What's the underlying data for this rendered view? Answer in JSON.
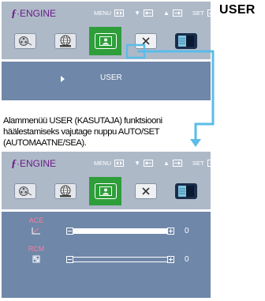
{
  "page": {
    "title": "USER",
    "instruction": "Alammenüü USER (KASUTAJA) funktsiooni häälestamiseks vajutage nuppu AUTO/SET (AUTOMAATNE/SEA)."
  },
  "osd": {
    "brand": "ENGINE",
    "brand_icon": "f-engine-logo",
    "keys": [
      "MENU",
      "SET"
    ],
    "tabs": [
      {
        "name": "movie",
        "icon": "film-reel-icon"
      },
      {
        "name": "internet",
        "icon": "globe-icon"
      },
      {
        "name": "user",
        "icon": "user-mode-icon",
        "selected": true
      },
      {
        "name": "normal",
        "icon": "close-x-icon"
      },
      {
        "name": "demo",
        "icon": "demo-split-icon"
      }
    ]
  },
  "top_panel": {
    "submenu_item": "USER"
  },
  "bottom_panel": {
    "items": [
      {
        "label": "ACE",
        "icon": "ace-icon",
        "value": "0",
        "level": 1.0
      },
      {
        "label": "RCM",
        "icon": "rcm-icon",
        "value": "0",
        "level": 0.0
      }
    ]
  },
  "colors": {
    "osd_background": "#aeb9c8",
    "selected_tab": "#2e9e3a",
    "submenu_background": "#6f87a8",
    "connector": "#5bbce8",
    "label_pink": "#fb7ea2",
    "brand_purple": "#6a1e86"
  }
}
